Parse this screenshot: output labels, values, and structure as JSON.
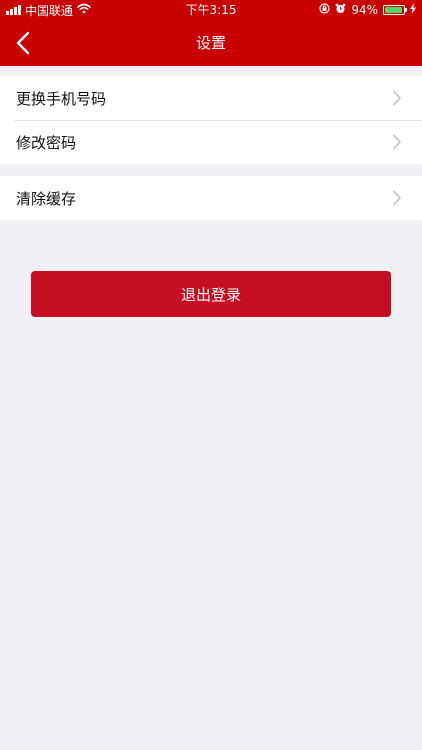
{
  "status_bar": {
    "carrier": "中国联通",
    "time": "下午3:15",
    "battery_percent": "94%",
    "battery_level": 0.94,
    "battery_color": "#4cd964"
  },
  "header": {
    "title": "设置",
    "back_icon": "chevron-left-icon",
    "background": "#c80000"
  },
  "settings": {
    "groups": [
      {
        "items": [
          {
            "label": "更换手机号码",
            "icon": "chevron-right-icon"
          },
          {
            "label": "修改密码",
            "icon": "chevron-right-icon"
          }
        ]
      },
      {
        "items": [
          {
            "label": "清除缓存",
            "icon": "chevron-right-icon"
          }
        ]
      }
    ]
  },
  "logout": {
    "label": "退出登录",
    "color": "#c60f22"
  }
}
